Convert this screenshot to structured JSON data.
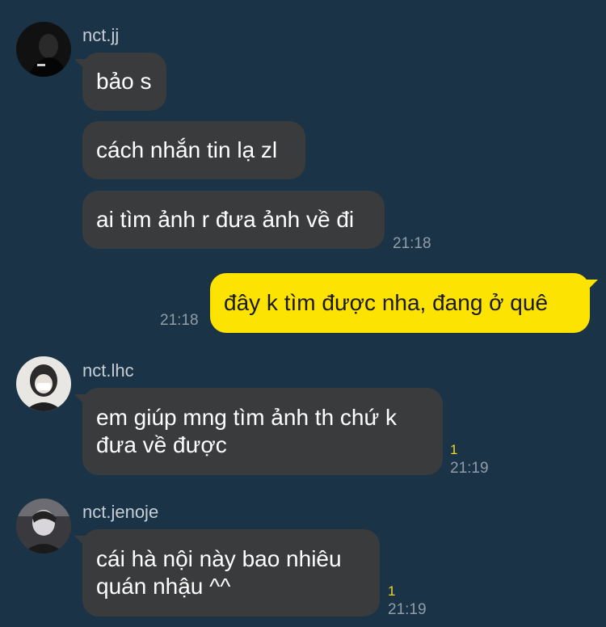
{
  "messages": [
    {
      "sender": "nct.jj",
      "avatar": "user-avatar-jj",
      "lines": [
        "bảo s",
        "cách nhắn tin lạ zl",
        "ai tìm ảnh r đưa ảnh về đi"
      ],
      "time": "21:18"
    },
    {
      "sender": "me",
      "text": "đây k tìm được nha, đang ở quê",
      "time": "21:18"
    },
    {
      "sender": "nct.lhc",
      "avatar": "user-avatar-lhc",
      "line1": "em giúp mng tìm ảnh th chứ k",
      "line2": "đưa về được",
      "unread": "1",
      "time": "21:19"
    },
    {
      "sender": "nct.jenoje",
      "avatar": "user-avatar-jenoje",
      "line1": "cái hà nội này bao nhiêu",
      "line2": "quán nhậu ^^",
      "unread": "1",
      "time": "21:19"
    }
  ],
  "colors": {
    "background": "#1b3346",
    "incoming_bubble": "#3a3b3d",
    "outgoing_bubble": "#fde302",
    "unread_count": "#f2d722"
  }
}
